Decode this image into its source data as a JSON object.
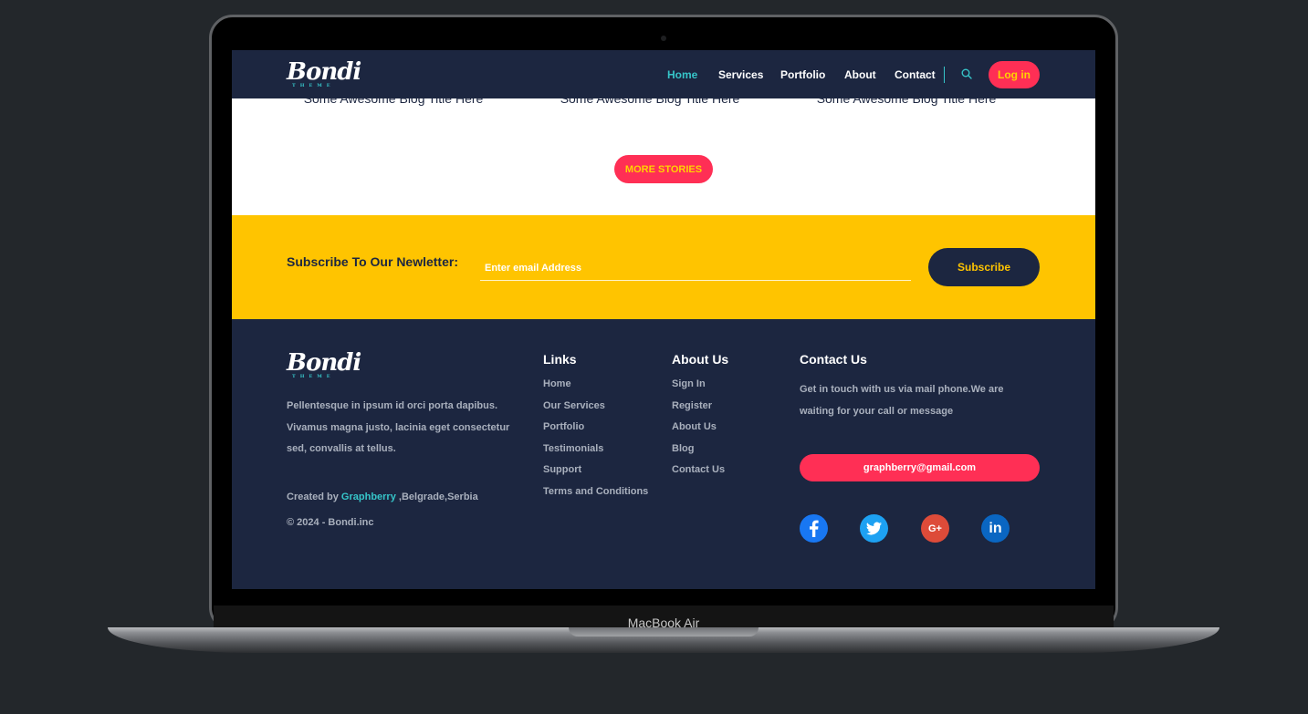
{
  "device": {
    "label": "MacBook Air"
  },
  "nav": {
    "logo_name": "Bondi",
    "logo_sub": "THEME",
    "items": [
      {
        "label": "Home",
        "active": true
      },
      {
        "label": "Services",
        "active": false
      },
      {
        "label": "Portfolio",
        "active": false
      },
      {
        "label": "About",
        "active": false
      },
      {
        "label": "Contact",
        "active": false
      }
    ],
    "search_icon": "search-icon",
    "login_label": "Log in"
  },
  "blog": {
    "titles": [
      "Some Awesome Blog Title Here",
      "Some Awesome Blog Title Here",
      "Some Awesome Blog Title Here"
    ],
    "more_label": "MORE STORIES"
  },
  "subscribe": {
    "label": "Subscribe To Our Newletter:",
    "placeholder": "Enter email Address",
    "button_label": "Subscribe"
  },
  "footer": {
    "logo_name": "Bondi",
    "logo_sub": "THEME",
    "description": "Pellentesque in ipsum id orci porta dapibus. Vivamus magna justo, lacinia eget consectetur sed, convallis at tellus.",
    "credit_prefix": "Created by ",
    "credit_brand": "Graphberry",
    "credit_suffix": " ,Belgrade,Serbia",
    "copyright": "© 2024 - Bondi.inc",
    "links": {
      "title": "Links",
      "items": [
        "Home",
        "Our Services",
        "Portfolio",
        "Testimonials",
        "Support",
        "Terms and Conditions"
      ]
    },
    "about": {
      "title": "About Us",
      "items": [
        "Sign In",
        "Register",
        "About Us",
        "Blog",
        "Contact Us"
      ]
    },
    "contact": {
      "title": "Contact Us",
      "text": "Get in touch with us via mail phone.We are waiting for your call or message",
      "email": "graphberry@gmail.com"
    },
    "social": [
      {
        "icon": "facebook-icon",
        "glyph": "f",
        "color": "#1877f2"
      },
      {
        "icon": "twitter-icon",
        "glyph": "t",
        "color": "#1da1f2"
      },
      {
        "icon": "google-plus-icon",
        "glyph": "G+",
        "color": "#dd4b39"
      },
      {
        "icon": "linkedin-icon",
        "glyph": "in",
        "color": "#0a66c2"
      }
    ]
  },
  "colors": {
    "navy": "#1c2640",
    "accent_pink": "#ff2f55",
    "accent_yellow": "#ffc400",
    "accent_teal": "#36c5c9"
  }
}
